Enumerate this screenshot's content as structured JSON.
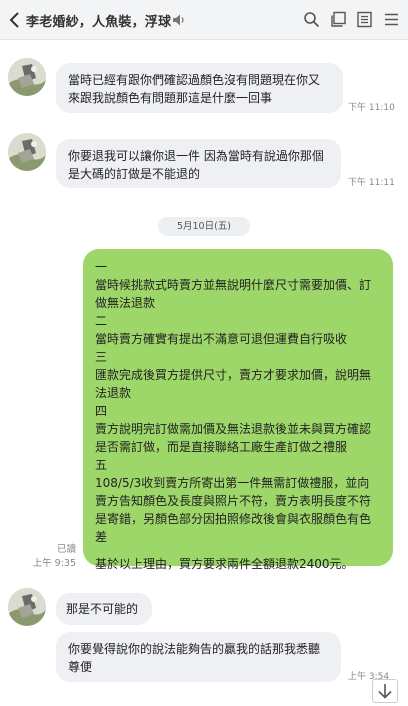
{
  "header": {
    "title": "李老婚紗，人魚裝，浮球"
  },
  "messages": {
    "m1": {
      "text": "當時已經有跟你們確認過顏色沒有問題現在你又來跟我說顏色有問題那這是什麼一回事",
      "time": "下午 11:10"
    },
    "m2": {
      "text": "你要退我可以讓你退一件 因為當時有說過你那個是大碼的訂做是不能退的",
      "time": "下午 11:11"
    },
    "date": "5月10日(五)",
    "m3": {
      "lines": [
        "一",
        "當時候挑款式時賣方並無說明什麼尺寸需要加價、訂做無法退款",
        "二",
        "當時賣方確實有提出不滿意可退但運費自行吸收",
        "三",
        "匯款完成後買方提供尺寸，賣方才要求加價，說明無法退款",
        "四",
        "賣方說明完訂做需加價及無法退款後並未與買方確認是否需訂做，而是直接聯絡工廠生產訂做之禮服",
        "五",
        "108/5/3收到賣方所寄出第一件無需訂做禮服，並向賣方告知顏色及長度與照片不符，賣方表明長度不符是寄錯，另顏色部分因拍照修改後會與衣服顏色有色差",
        "",
        "基於以上理由，買方要求兩件全額退款2400元。"
      ],
      "read": "已讀",
      "time": "上午 9:35"
    },
    "m4": {
      "text": "那是不可能的"
    },
    "m5": {
      "text": "你要覺得說你的說法能夠告的贏我的話那我悉聽尊便",
      "time": "上午 3:54"
    }
  }
}
